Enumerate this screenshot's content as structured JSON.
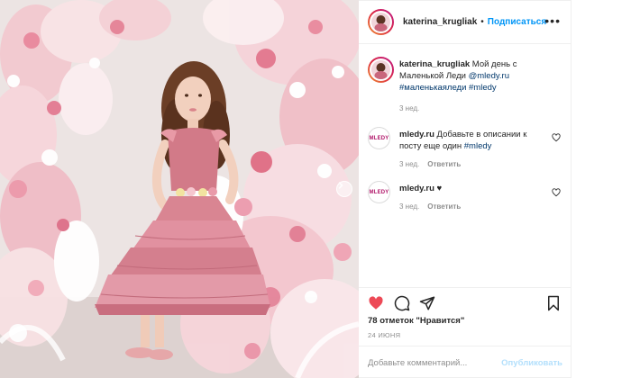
{
  "post": {
    "username": "katerina_krugliak",
    "follow_label": "Подписаться",
    "dot": "•",
    "more_label": "•••"
  },
  "comments": [
    {
      "author": "katerina_krugliak",
      "text": "Мой день с Маленькой Леди",
      "mention": "@mledy.ru",
      "hashtags": "#маленькаяледи #mledy",
      "time": "3 нед."
    },
    {
      "author": "mledy.ru",
      "avatar_text": "MLEDY",
      "text": "Добавьте в описании к посту еще один",
      "hashtag": "#mledy",
      "time": "3 нед.",
      "reply_label": "Ответить"
    },
    {
      "author": "mledy.ru",
      "avatar_text": "MLEDY",
      "text": "♥",
      "time": "3 нед.",
      "reply_label": "Ответить"
    }
  ],
  "actions": {
    "likes": "78 отметок \"Нравится\"",
    "date": "24 ИЮНЯ",
    "like_color": "#ed4956"
  },
  "add_comment": {
    "placeholder": "Добавьте комментарий...",
    "post_label": "Опубликовать"
  },
  "colors": {
    "link": "#0095f6",
    "mention": "#00376b",
    "muted": "#8e8e8e",
    "dress_pink": "#d9808e"
  },
  "icons": [
    "heart-icon",
    "comment-icon",
    "share-icon",
    "bookmark-icon",
    "more-icon",
    "chevron-right-icon"
  ]
}
